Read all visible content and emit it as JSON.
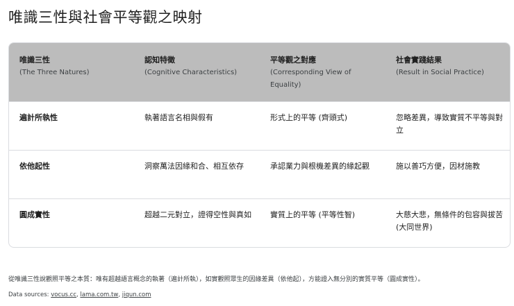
{
  "title": "唯識三性與社會平等觀之映射",
  "table": {
    "headers": [
      {
        "zh": "唯識三性",
        "en": "(The Three Natures)"
      },
      {
        "zh": "認知特徵",
        "en": "(Cognitive Characteristics)"
      },
      {
        "zh": "平等觀之對應",
        "en": "(Corresponding View of Equality)"
      },
      {
        "zh": "社會實踐結果",
        "en": "(Result in Social Practice)"
      }
    ],
    "rows": [
      [
        "遍計所執性",
        "執著語言名相與假有",
        "形式上的平等 (齊頭式)",
        "忽略差異，導致實質不平等與對立"
      ],
      [
        "依他起性",
        "洞察萬法因緣和合、相互依存",
        "承認業力與根機差異的緣起觀",
        "施以善巧方便，因材施教"
      ],
      [
        "圓成實性",
        "超越二元對立，證得空性與真如",
        "實質上的平等 (平等性智)",
        "大慈大悲，無條件的包容與拔苦 (大同世界)"
      ]
    ]
  },
  "footnote": "從唯識三性說觀照平等之本質：唯有超越語言概念的執著（遍計所執），如實觀照眾生的因緣差異（依他起），方能證入無分別的實質平等（圓成實性）。",
  "sources": {
    "label": "Data sources:",
    "links": [
      "vocus.cc",
      "lama.com.tw",
      "jiqun.com"
    ]
  }
}
